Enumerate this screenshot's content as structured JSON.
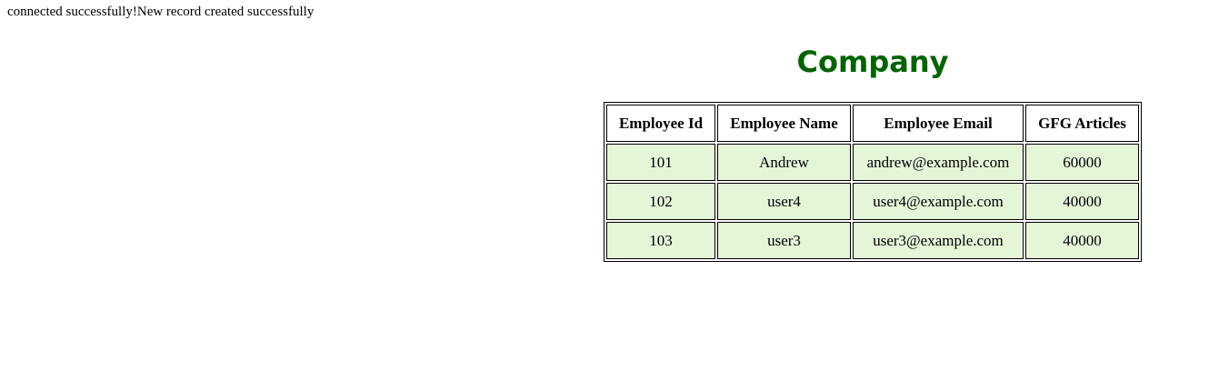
{
  "status_message": "connected successfully!New record created successfully",
  "title": "Company",
  "colors": {
    "title": "#006400",
    "row_background": "#e4f5d8",
    "border": "#000000"
  },
  "table": {
    "headers": [
      "Employee Id",
      "Employee Name",
      "Employee Email",
      "GFG Articles"
    ],
    "rows": [
      [
        "101",
        "Andrew",
        "andrew@example.com",
        "60000"
      ],
      [
        "102",
        "user4",
        "user4@example.com",
        "40000"
      ],
      [
        "103",
        "user3",
        "user3@example.com",
        "40000"
      ]
    ]
  }
}
